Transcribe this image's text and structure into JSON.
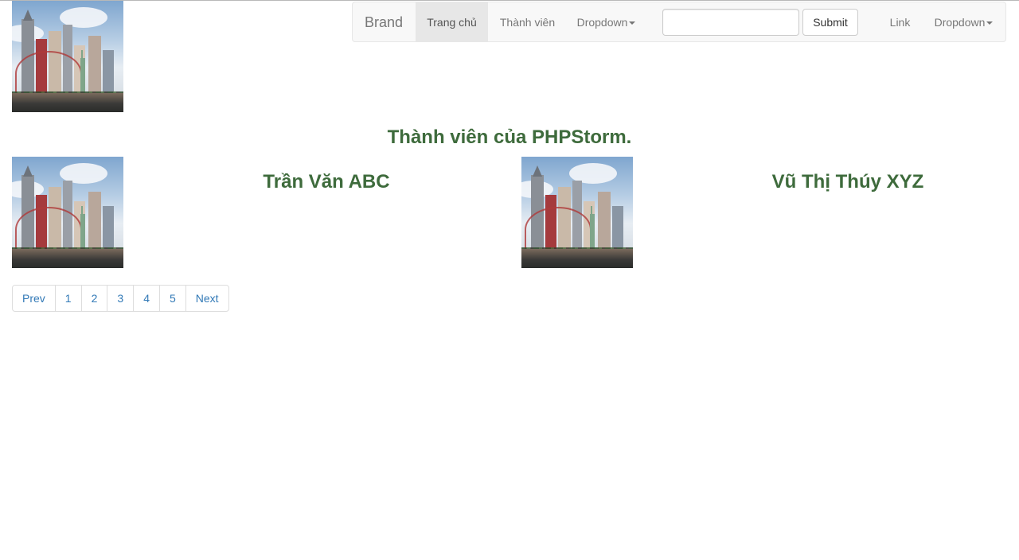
{
  "navbar": {
    "brand": "Brand",
    "items": [
      {
        "label": "Trang chủ",
        "active": true
      },
      {
        "label": "Thành viên",
        "active": false
      },
      {
        "label": "Dropdown",
        "active": false
      }
    ],
    "search_value": "",
    "submit_label": "Submit",
    "right_items": [
      {
        "label": "Link"
      },
      {
        "label": "Dropdown"
      }
    ]
  },
  "page_title": "Thành viên của PHPStorm.",
  "members": [
    {
      "name": "Trần Văn ABC"
    },
    {
      "name": "Vũ Thị Thúy XYZ"
    }
  ],
  "pagination": [
    "Prev",
    "1",
    "2",
    "3",
    "4",
    "5",
    "Next"
  ],
  "colors": {
    "heading": "#3e6b3c",
    "link": "#337ab7",
    "navbar_bg": "#f8f8f8",
    "navbar_active_bg": "#e7e7e7"
  },
  "icons": {
    "caret": "caret-down-icon"
  }
}
